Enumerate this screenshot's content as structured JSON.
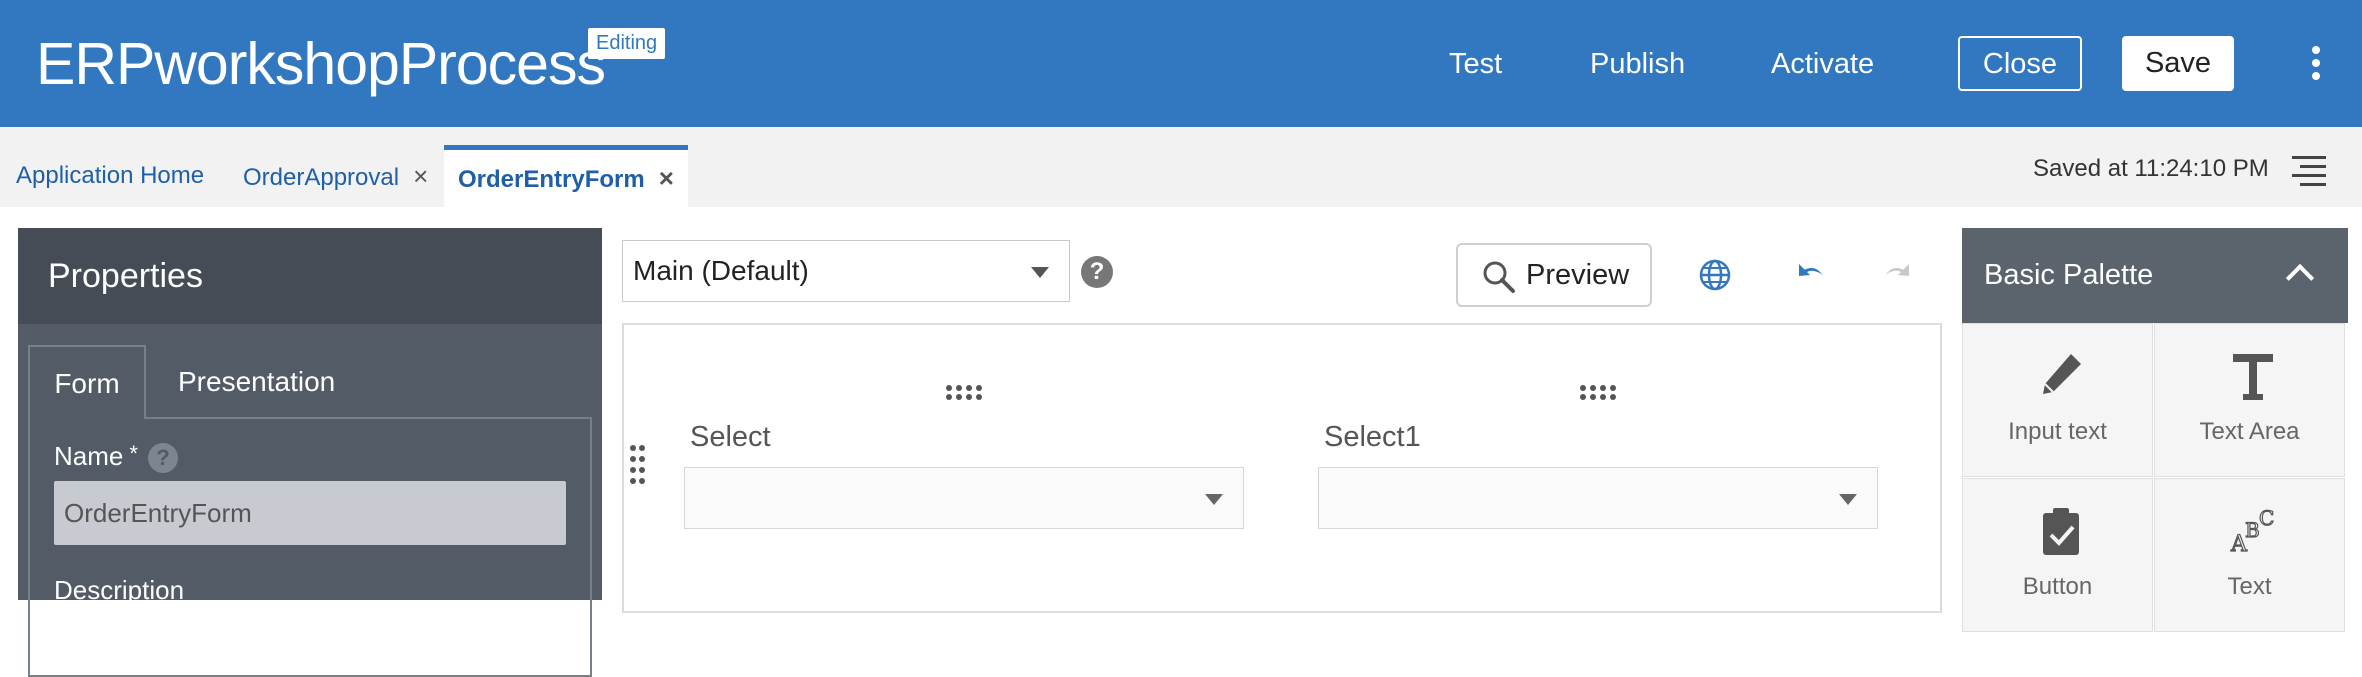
{
  "header": {
    "app_title": "ERPworkshopProcess",
    "badge": "Editing",
    "links": [
      "Test",
      "Publish",
      "Activate"
    ],
    "close_label": "Close",
    "save_label": "Save"
  },
  "tabs": {
    "items": [
      {
        "label": "Application Home"
      },
      {
        "label": "OrderApproval",
        "close": "×"
      },
      {
        "label": "OrderEntryForm",
        "close": "×",
        "active": true
      }
    ],
    "saved_status": "Saved at 11:24:10 PM"
  },
  "properties": {
    "title": "Properties",
    "tabs": [
      "Form",
      "Presentation"
    ],
    "name_label": "Name",
    "required_mark": "*",
    "help": "?",
    "name_value": "OrderEntryForm",
    "description_label": "Description"
  },
  "toolbar": {
    "layout_select": "Main (Default)",
    "help": "?",
    "preview_label": "Preview"
  },
  "canvas": {
    "fields": [
      {
        "label": "Select",
        "value": ""
      },
      {
        "label": "Select1",
        "value": ""
      }
    ]
  },
  "palette": {
    "title": "Basic Palette",
    "items": [
      {
        "label": "Input text",
        "icon": "pencil-icon"
      },
      {
        "label": "Text Area",
        "icon": "text-t-icon"
      },
      {
        "label": "Button",
        "icon": "clipboard-check-icon"
      },
      {
        "label": "Text",
        "icon": "abc-text-icon"
      }
    ]
  },
  "colors": {
    "header_bg": "#3178c1",
    "panel_dark": "#525b66",
    "palette_head": "#5b636d",
    "link_blue": "#1f5fa8"
  }
}
